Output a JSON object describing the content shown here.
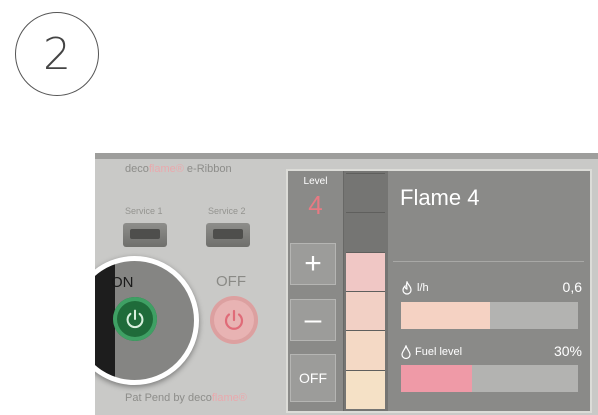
{
  "step_number": "2",
  "device": {
    "brand_name": "deco",
    "brand_accent": "flame®",
    "brand_suffix": " e-Ribbon",
    "service1_label": "Service 1",
    "service2_label": "Service 2",
    "on_label": "ON",
    "off_label": "OFF",
    "footer_prefix": "Pat Pend by deco",
    "footer_accent": "flame®"
  },
  "controller": {
    "level_label": "Level",
    "level_value": "4",
    "plus_label": "+",
    "minus_label": "–",
    "off_label": "OFF",
    "level_segments": {
      "total": 6,
      "active": 4,
      "active_colors": [
        "#f0c7c5",
        "#f2d0c5",
        "#f4d9c5",
        "#f5e1c6"
      ],
      "inactive_color": "#757573"
    },
    "flame_title": "Flame 4",
    "consumption": {
      "icon": "flame-icon",
      "label": "l/h",
      "value": "0,6",
      "fill_fraction": 0.5,
      "fill_color": "#f5d2c3"
    },
    "fuel": {
      "icon": "drop-icon",
      "label": "Fuel level",
      "value": "30%",
      "fill_fraction": 0.4,
      "fill_color": "#ef9aa7"
    }
  },
  "colors": {
    "on_green": "#1f6b3a",
    "off_pink": "#e8b3b3",
    "accent_pink": "#e77a83"
  }
}
